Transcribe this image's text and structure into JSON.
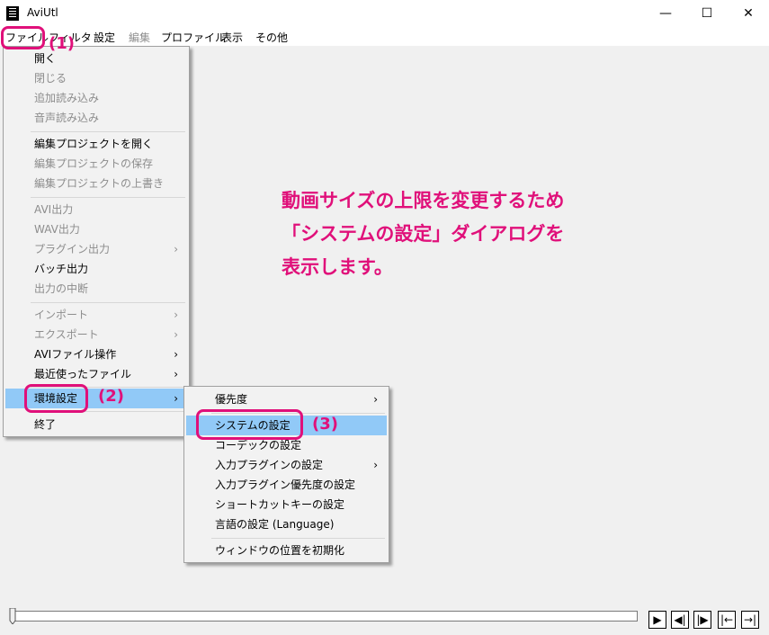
{
  "window": {
    "title": "AviUtl",
    "minimize_glyph": "—",
    "maximize_glyph": "☐",
    "close_glyph": "✕"
  },
  "menubar": [
    "ファイル",
    "フィルタ",
    "設定",
    "編集",
    "プロファイル",
    "表示",
    "その他"
  ],
  "file_menu": {
    "items": [
      {
        "label": "開く",
        "disabled": false
      },
      {
        "label": "閉じる",
        "disabled": true
      },
      {
        "label": "追加読み込み",
        "disabled": true
      },
      {
        "label": "音声読み込み",
        "disabled": true
      },
      {
        "label": "編集プロジェクトを開く",
        "disabled": false
      },
      {
        "label": "編集プロジェクトの保存",
        "disabled": true
      },
      {
        "label": "編集プロジェクトの上書き",
        "disabled": true
      },
      {
        "label": "AVI出力",
        "disabled": true
      },
      {
        "label": "WAV出力",
        "disabled": true
      },
      {
        "label": "プラグイン出力",
        "disabled": true
      },
      {
        "label": "バッチ出力",
        "disabled": false
      },
      {
        "label": "出力の中断",
        "disabled": true
      },
      {
        "label": "インポート",
        "disabled": true
      },
      {
        "label": "エクスポート",
        "disabled": true
      },
      {
        "label": "AVIファイル操作",
        "disabled": false
      },
      {
        "label": "最近使ったファイル",
        "disabled": false
      },
      {
        "label": "環境設定",
        "disabled": false
      },
      {
        "label": "終了",
        "disabled": false
      }
    ],
    "submenu_arrow": "›"
  },
  "env_submenu": {
    "items": [
      "優先度",
      "システムの設定",
      "コーデックの設定",
      "入力プラグインの設定",
      "入力プラグイン優先度の設定",
      "ショートカットキーの設定",
      "言語の設定 (Language)",
      "ウィンドウの位置を初期化"
    ]
  },
  "annotations": {
    "step1": "(1)",
    "step2": "(2)",
    "step3": "(3)",
    "message_line1": "動画サイズの上限を変更するため",
    "message_line2": "「システムの設定」ダイアログを",
    "message_line3": "表示します。",
    "color": "#e0107a"
  },
  "transport": {
    "play": "▶",
    "prev_frame": "◀|",
    "next_frame": "|▶",
    "to_start": "|←",
    "to_end": "→|"
  }
}
